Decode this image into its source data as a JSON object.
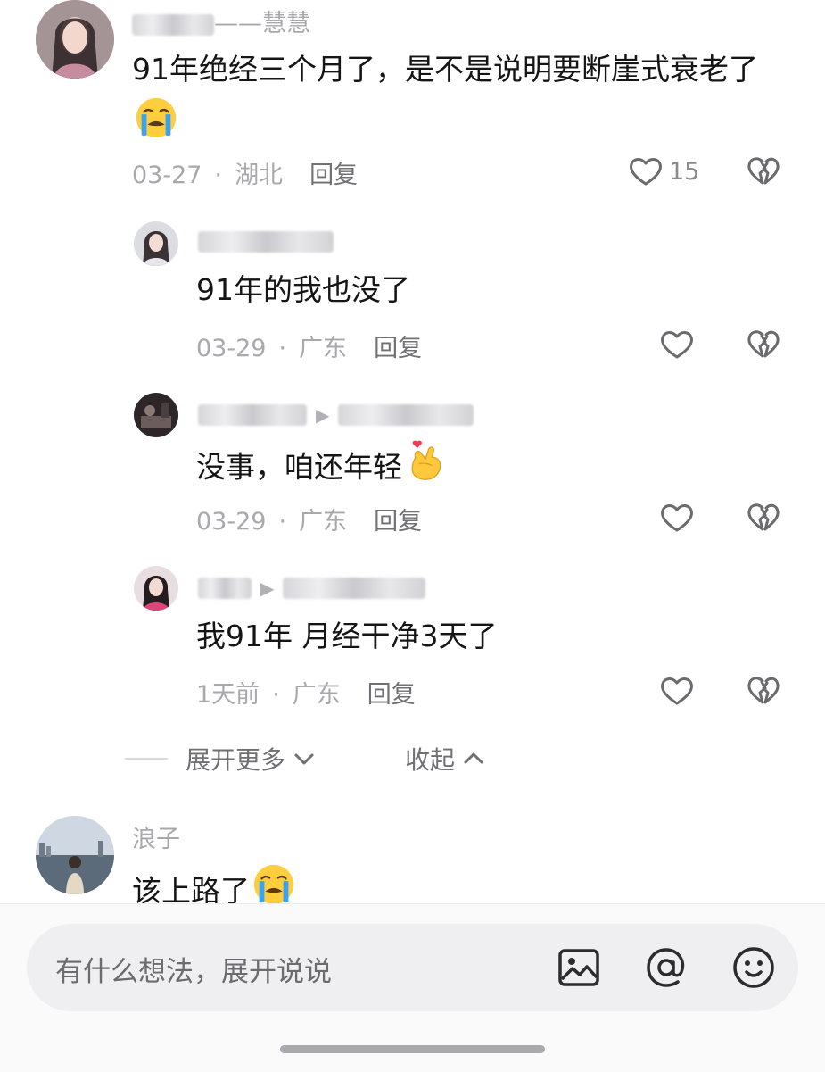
{
  "colors": {
    "text": "#151515",
    "muted": "#a8a8ad",
    "reply": "#707075",
    "icon": "#6a6a6f",
    "input_bg": "#efeff1"
  },
  "comments": [
    {
      "username": "——慧慧",
      "text": "91年绝经三个月了，是不是说明要断崖式衰老了",
      "emoji": "loudly-crying-face",
      "date": "03-27",
      "location": "湖北",
      "reply": "回复",
      "likes": "15"
    },
    {
      "text": "91年的我也没了",
      "date": "03-29",
      "location": "广东",
      "reply": "回复"
    },
    {
      "text": "没事，咱还年轻",
      "emoji": "finger-heart",
      "date": "03-29",
      "location": "广东",
      "reply": "回复"
    },
    {
      "text": "我91年 月经干净3天了",
      "date": "1天前",
      "location": "广东",
      "reply": "回复"
    },
    {
      "username": "浪子",
      "text": "该上路了",
      "emoji": "loudly-crying-face"
    }
  ],
  "thread": {
    "expand_more": "展开更多",
    "collapse": "收起"
  },
  "input": {
    "placeholder": "有什么想法，展开说说"
  },
  "icons": [
    "heart-icon",
    "broken-heart-icon",
    "image-icon",
    "at-icon",
    "emoji-icon",
    "chevron-down-icon",
    "chevron-up-icon"
  ]
}
